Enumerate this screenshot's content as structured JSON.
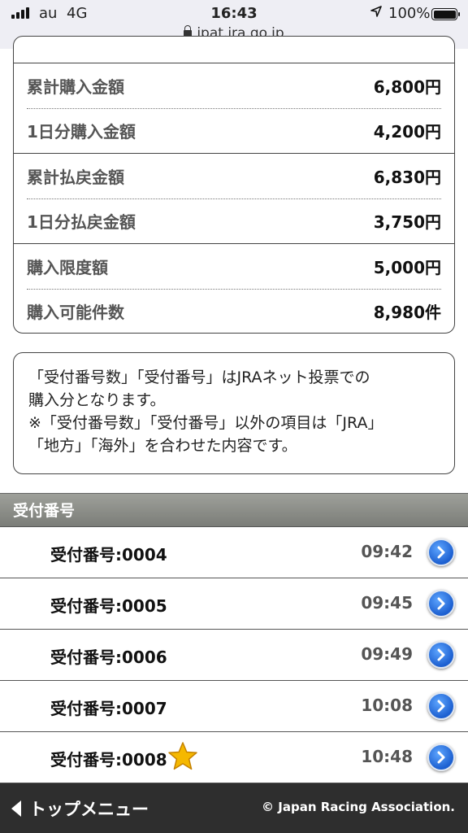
{
  "status_bar": {
    "carrier": "au",
    "network": "4G",
    "time": "16:43",
    "battery": "100%",
    "url": "ipat.jra.go.jp"
  },
  "summary": {
    "rows": [
      {
        "label": "累計購入金額",
        "value": "6,800円"
      },
      {
        "label": "1日分購入金額",
        "value": "4,200円"
      },
      {
        "label": "累計払戻金額",
        "value": "6,830円"
      },
      {
        "label": "1日分払戻金額",
        "value": "3,750円"
      },
      {
        "label": "購入限度額",
        "value": "5,000円"
      },
      {
        "label": "購入可能件数",
        "value": "8,980件"
      }
    ]
  },
  "note": {
    "line1": "「受付番号数」「受付番号」はJRAネット投票での",
    "line2": "購入分となります。",
    "line3": "※「受付番号数」「受付番号」以外の項目は「JRA」",
    "line4": "「地方」「海外」を合わせた内容です。"
  },
  "section_title": "受付番号",
  "receipts": [
    {
      "label": "受付番号:0004",
      "time": "09:42",
      "starred": false
    },
    {
      "label": "受付番号:0005",
      "time": "09:45",
      "starred": false
    },
    {
      "label": "受付番号:0006",
      "time": "09:49",
      "starred": false
    },
    {
      "label": "受付番号:0007",
      "time": "10:08",
      "starred": false
    },
    {
      "label": "受付番号:0008",
      "time": "10:48",
      "starred": true
    }
  ],
  "footer": {
    "top_menu": "トップメニュー",
    "copyright": "© Japan Racing Association."
  },
  "colors": {
    "accent_blue": "#1c5fd0",
    "header_gray": "#8a8c87",
    "footer_bg": "#2e2e2e",
    "star": "#f5b800"
  },
  "icons": {
    "status": [
      "signal-icon",
      "location-icon",
      "battery-icon",
      "lock-icon"
    ],
    "row_action": "chevron-right-circle-icon",
    "favorite": "star-icon",
    "back": "back-triangle-icon"
  }
}
